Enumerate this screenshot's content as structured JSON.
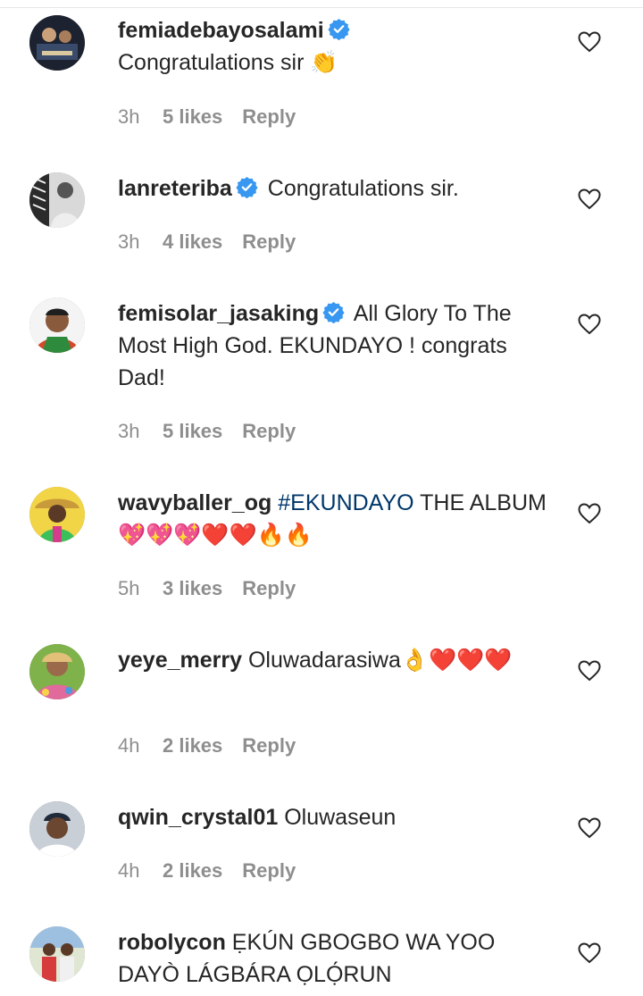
{
  "comments": [
    {
      "username": "femiadebayosalami",
      "verified": true,
      "text": "Congratulations sir",
      "emoji": "👏",
      "time": "3h",
      "likes": "5 likes",
      "reply": "Reply"
    },
    {
      "username": "lanreteriba",
      "verified": true,
      "text": "Congratulations sir.",
      "time": "3h",
      "likes": "4 likes",
      "reply": "Reply"
    },
    {
      "username": "femisolar_jasaking",
      "verified": true,
      "text": "All Glory To The Most High God. EKUNDAYO ! congrats Dad!",
      "time": "3h",
      "likes": "5 likes",
      "reply": "Reply"
    },
    {
      "username": "wavyballer_og",
      "verified": false,
      "hashtag": "#EKUNDAYO",
      "text": "THE ALBUM",
      "emoji": "💖💖💖❤️❤️🔥🔥",
      "time": "5h",
      "likes": "3 likes",
      "reply": "Reply"
    },
    {
      "username": "yeye_merry",
      "verified": false,
      "text": "Oluwadarasiwa",
      "emoji": "👌❤️❤️❤️",
      "time": "4h",
      "likes": "2 likes",
      "reply": "Reply"
    },
    {
      "username": "qwin_crystal01",
      "verified": false,
      "text": "Oluwaseun",
      "time": "4h",
      "likes": "2 likes",
      "reply": "Reply"
    },
    {
      "username": "robolycon",
      "verified": false,
      "text": "ẸKÚN GBOGBO WA YOO DAYÒ LÁGBÁRA ỌLỌ́RUN"
    }
  ],
  "colors": {
    "text": "#262626",
    "meta": "#8e8e8e",
    "hashtag": "#00376b",
    "verified_blue": "#3897f0"
  }
}
